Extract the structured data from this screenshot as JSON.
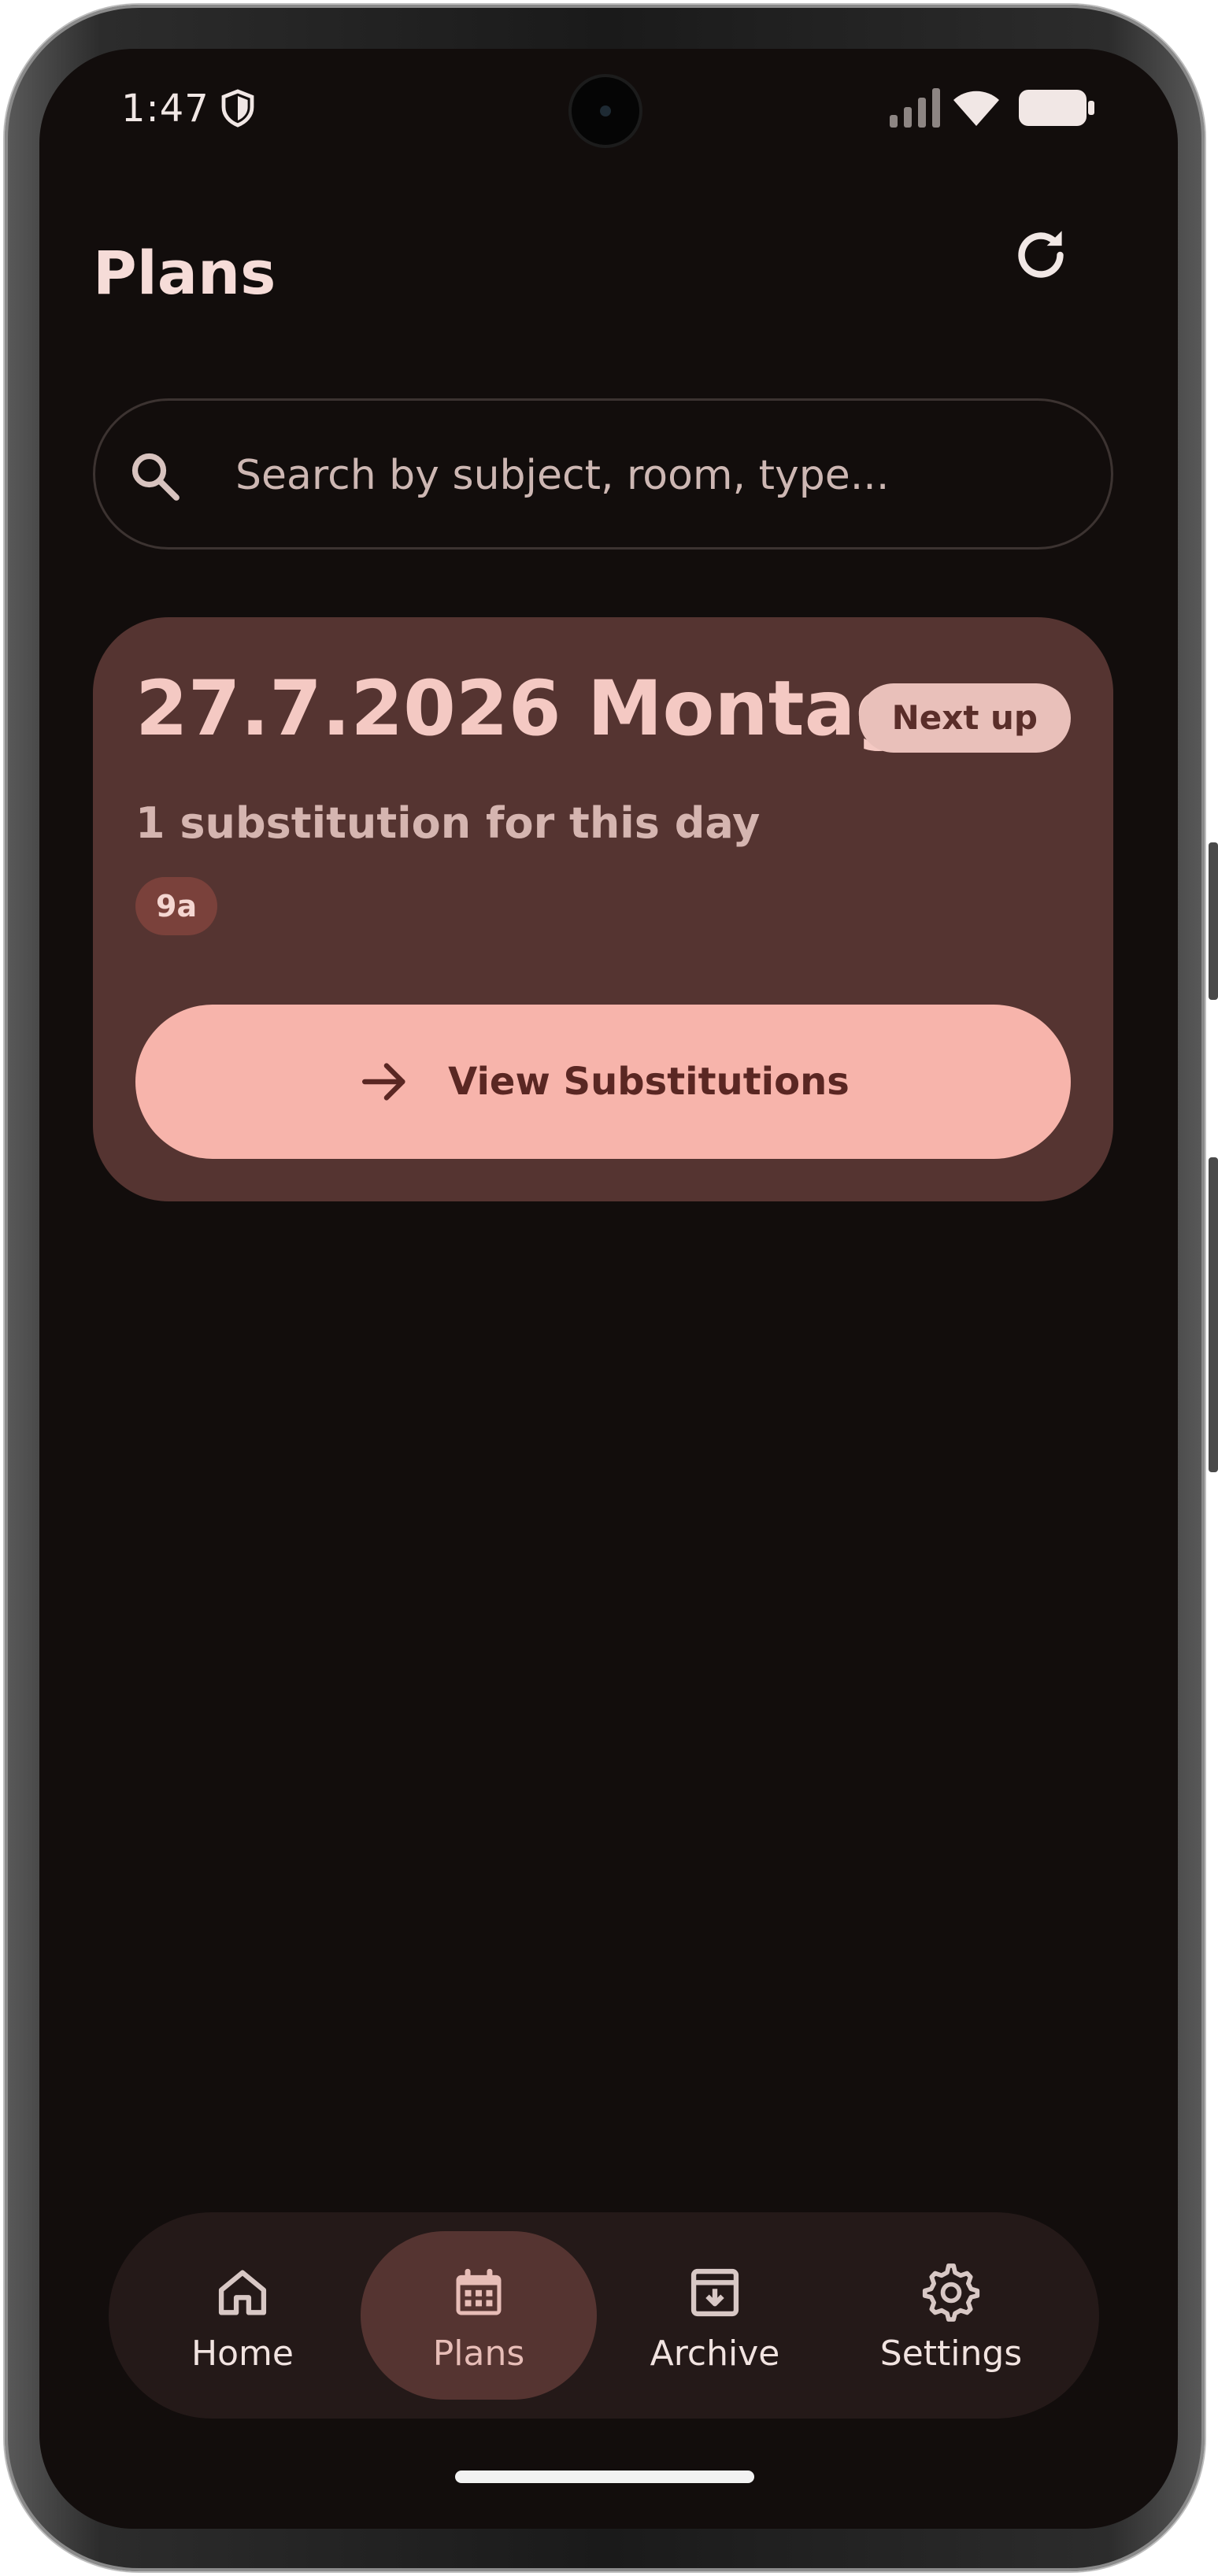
{
  "status_bar": {
    "time": "1:47",
    "icons": [
      "shield-icon",
      "signal-icon",
      "wifi-icon",
      "battery-icon"
    ]
  },
  "header": {
    "title": "Plans",
    "refresh_icon": "refresh-icon"
  },
  "search": {
    "placeholder": "Search by subject, room, type...",
    "value": ""
  },
  "card": {
    "date": "27.7.2026 Montag",
    "badge": "Next up",
    "summary": "1 substitution for this day",
    "class_chip": "9a",
    "button_label": "View Substitutions"
  },
  "nav": {
    "items": [
      {
        "label": "Home",
        "icon": "home-icon",
        "active": false
      },
      {
        "label": "Plans",
        "icon": "calendar-icon",
        "active": true
      },
      {
        "label": "Archive",
        "icon": "archive-icon",
        "active": false
      },
      {
        "label": "Settings",
        "icon": "gear-icon",
        "active": false
      }
    ]
  },
  "colors": {
    "background": "#120d0c",
    "card": "#553431",
    "accent_button": "#f7b4ab",
    "badge": "#e9c0ba",
    "nav_bar": "#241918",
    "title_text": "#f6dcd8"
  }
}
